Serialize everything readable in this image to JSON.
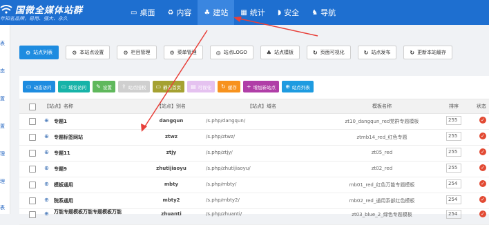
{
  "header": {
    "logo_title": "国微全媒体站群",
    "logo_sub": "年知名品牌，易用、强大、永久",
    "nav": [
      {
        "label": "桌面",
        "icon": "▭"
      },
      {
        "label": "内容",
        "icon": "♻"
      },
      {
        "label": "建站",
        "icon": "♣"
      },
      {
        "label": "统计",
        "icon": "▦"
      },
      {
        "label": "安全",
        "icon": "◗"
      },
      {
        "label": "导航",
        "icon": "♞"
      }
    ]
  },
  "leftbar": [
    "表",
    "态",
    "置",
    "置",
    "理",
    "理",
    "表"
  ],
  "toolbar": [
    {
      "label": "站点列表",
      "icon": "⚙"
    },
    {
      "label": "本站点设置",
      "icon": "⚙"
    },
    {
      "label": "栏目管理",
      "icon": "⚙"
    },
    {
      "label": "菜单管理",
      "icon": "⚙"
    },
    {
      "label": "站点LOGO",
      "icon": "◎"
    },
    {
      "label": "站点模板",
      "icon": "♣"
    },
    {
      "label": "页面可视化",
      "icon": "↻"
    },
    {
      "label": "站点发布",
      "icon": "↻"
    },
    {
      "label": "更新本站缓存",
      "icon": "↻"
    }
  ],
  "actions": [
    {
      "label": "动态访问",
      "icon": "▭",
      "color": "#1e8ce0"
    },
    {
      "label": "域名访问",
      "icon": "▭",
      "color": "#17b3a8"
    },
    {
      "label": "设置",
      "icon": "✎",
      "color": "#5fb85c"
    },
    {
      "label": "站点授权",
      "icon": "⇪",
      "color": "#cfcfcf"
    },
    {
      "label": "静态首页",
      "icon": "▭",
      "color": "#a5a132"
    },
    {
      "label": "可视化",
      "icon": "▤",
      "color": "#e5c2f0"
    },
    {
      "label": "缓存",
      "icon": "↻",
      "color": "#f7921e"
    },
    {
      "label": "增加新站点",
      "icon": "+",
      "color": "#b03ea7"
    },
    {
      "label": "站点列表",
      "icon": "⊕",
      "color": "#1e9be0"
    }
  ],
  "table": {
    "headers": {
      "name": "【站点】名称",
      "alias": "【站点】别名",
      "domain": "【站点】域名",
      "tpl": "模板名称",
      "sort": "排序",
      "status": "状态"
    },
    "rows": [
      {
        "name": "专题1",
        "alias": "dangqun",
        "domain": "/s.php/dangqun/",
        "tpl": "zt10_dangqun_red党群专题模板",
        "sort": "255"
      },
      {
        "name": "专题标签网站",
        "alias": "ztwz",
        "domain": "/s.php/ztwz/",
        "tpl": "ztmb14_red_红色专题",
        "sort": "255"
      },
      {
        "name": "专题11",
        "alias": "ztjy",
        "domain": "/s.php/ztjy/",
        "tpl": "zt05_red",
        "sort": "255"
      },
      {
        "name": "专题9",
        "alias": "zhutijiaoyu",
        "domain": "/s.php/zhutijiaoyu/",
        "tpl": "zt02_red",
        "sort": "255"
      },
      {
        "name": "模板通用",
        "alias": "mbty",
        "domain": "/s.php/mbty/",
        "tpl": "mb01_red_红色万能专题模板",
        "sort": "254"
      },
      {
        "name": "院系通用",
        "alias": "mbty2",
        "domain": "/s.php/mbty2/",
        "tpl": "mb02_red_通用系部红色模板",
        "sort": "254"
      },
      {
        "name": "万能专题模板万能专题模板万能",
        "alias": "zhuanti",
        "domain": "/s.php/zhuanti/",
        "tpl": "zt03_blue_2_绿色专题模板",
        "sort": "254"
      }
    ]
  },
  "colors": {
    "header_bg": "#1e6fd0",
    "accent": "#1e8ce0",
    "status_ok": "#e24a33",
    "arrow": "#e8403a"
  }
}
